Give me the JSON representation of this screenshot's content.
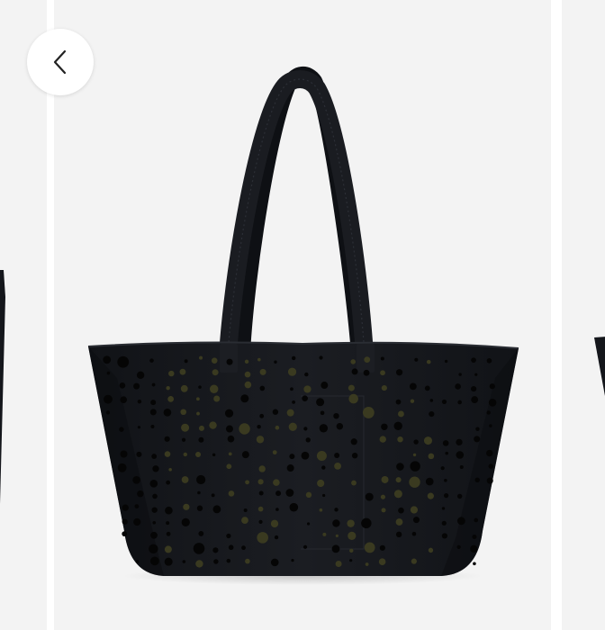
{
  "gallery": {
    "current_image": {
      "alt": ""
    },
    "back_button": {
      "icon": "chevron-left-icon"
    }
  },
  "colors": {
    "background": "#f3f3f3",
    "bag": "#14161b",
    "bag_highlight": "#2a2d33",
    "hole_dark": "#050505",
    "hole_olive": "#3a3a20"
  }
}
